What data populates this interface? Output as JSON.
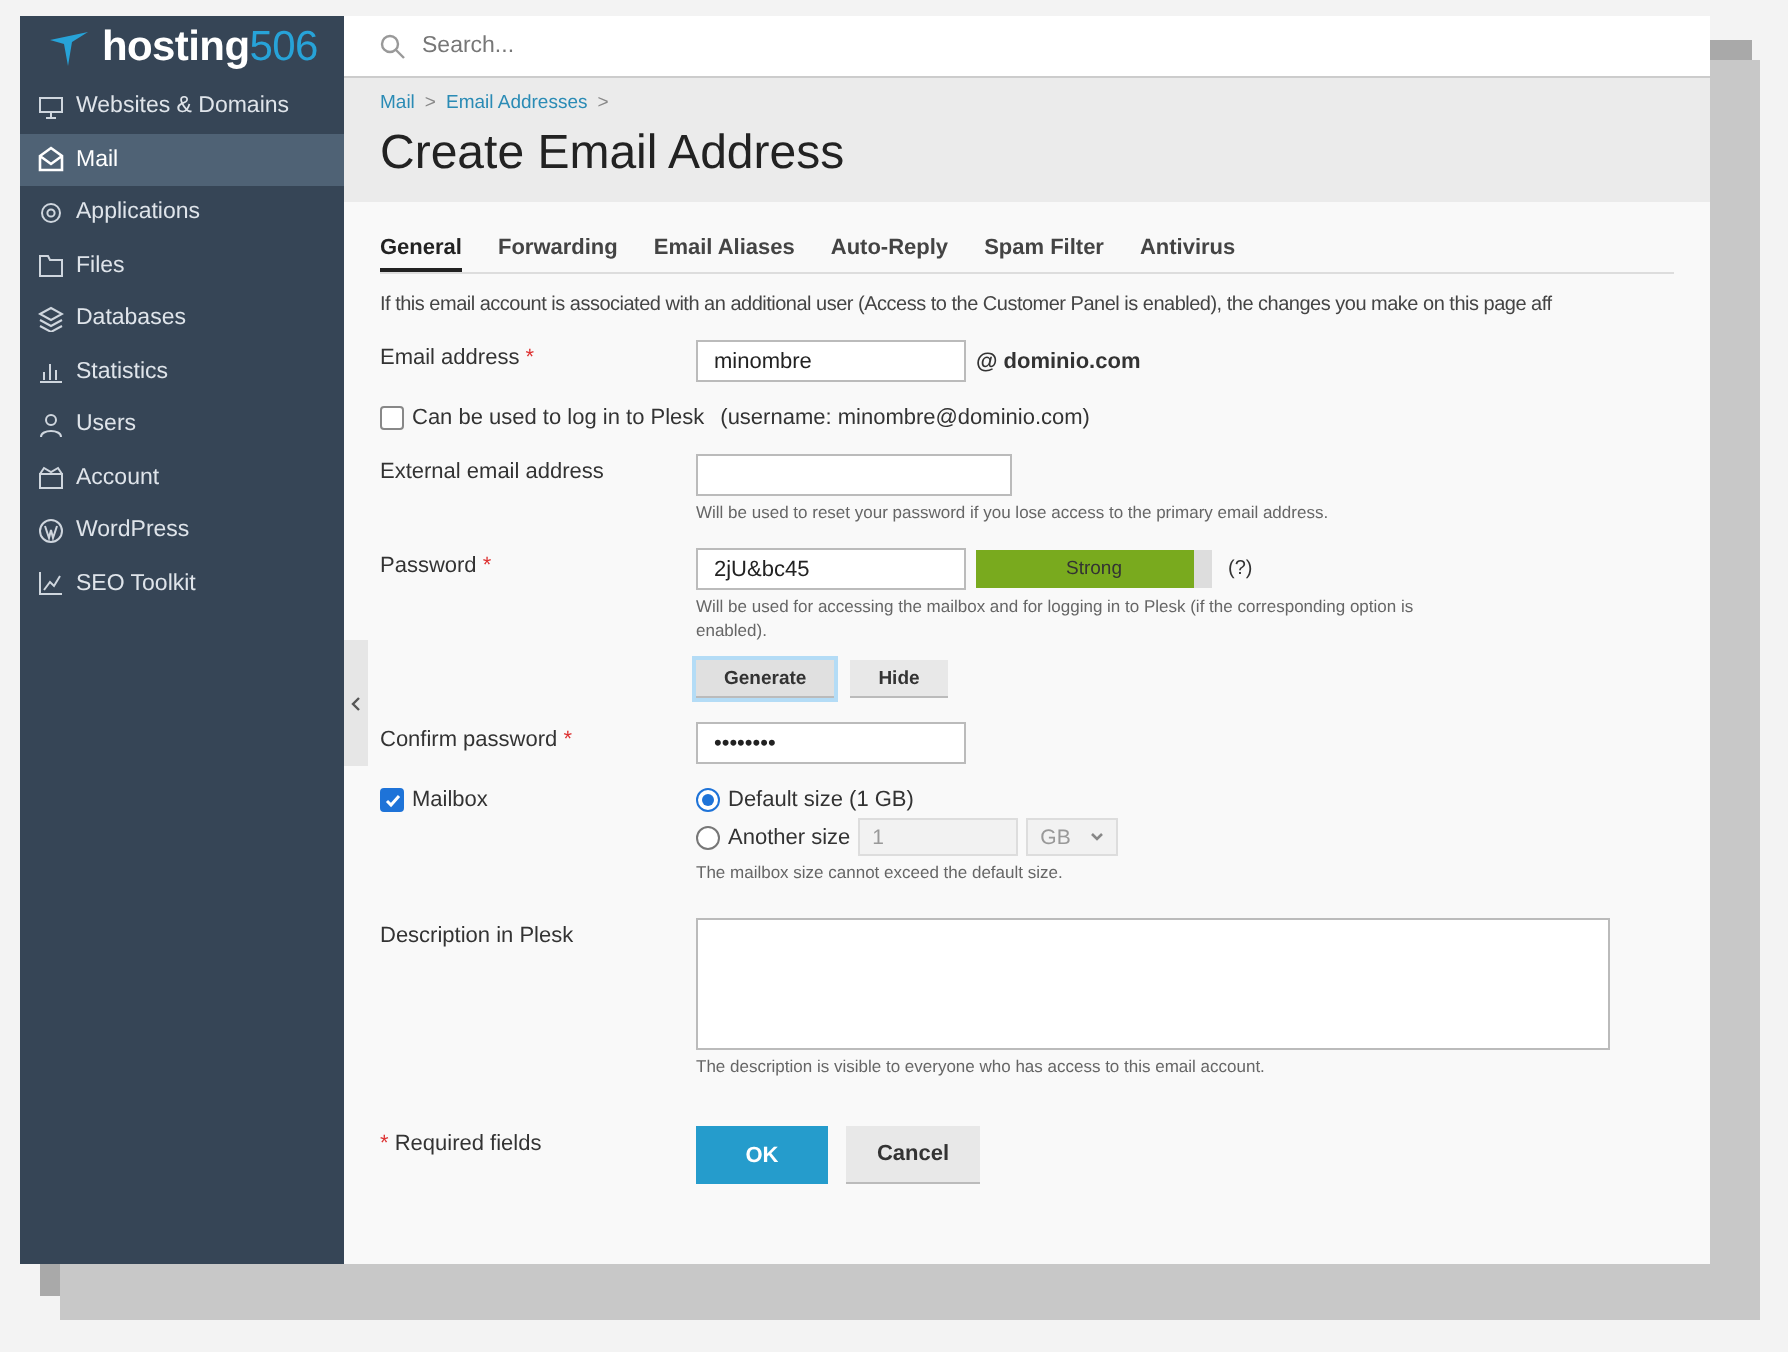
{
  "logo": {
    "name": "hosting",
    "suffix": "506"
  },
  "sidebar": {
    "items": [
      {
        "label": "Websites & Domains",
        "selected": false
      },
      {
        "label": "Mail",
        "selected": true
      },
      {
        "label": "Applications",
        "selected": false
      },
      {
        "label": "Files",
        "selected": false
      },
      {
        "label": "Databases",
        "selected": false
      },
      {
        "label": "Statistics",
        "selected": false
      },
      {
        "label": "Users",
        "selected": false
      },
      {
        "label": "Account",
        "selected": false
      },
      {
        "label": "WordPress",
        "selected": false
      },
      {
        "label": "SEO Toolkit",
        "selected": false
      }
    ]
  },
  "search": {
    "placeholder": "Search..."
  },
  "breadcrumbs": [
    {
      "label": "Mail",
      "separator": ">"
    },
    {
      "label": "Email Addresses",
      "separator": ">"
    }
  ],
  "page_title": "Create Email Address",
  "tabs": [
    {
      "label": "General",
      "selected": true
    },
    {
      "label": "Forwarding",
      "selected": false
    },
    {
      "label": "Email Aliases",
      "selected": false
    },
    {
      "label": "Auto-Reply",
      "selected": false
    },
    {
      "label": "Spam Filter",
      "selected": false
    },
    {
      "label": "Antivirus",
      "selected": false
    }
  ],
  "notice": "If this email account is associated with an additional user (Access to the Customer Panel is enabled), the changes you make on this page aff",
  "form": {
    "email": {
      "label": "Email address",
      "required": true,
      "value": "minombre",
      "domain": "@ dominio.com"
    },
    "login": {
      "label": "Can be used to log in to Plesk",
      "checked": false,
      "note": "(username: minombre@dominio.com)"
    },
    "external": {
      "label": "External email address",
      "hint": "Will be used to reset your password if you lose access to the primary email address."
    },
    "password": {
      "label": "Password",
      "required": true,
      "value": "2jU&bc45",
      "strength": {
        "label": "Strong",
        "level": 0.92
      },
      "help": "(?)",
      "hint": "Will be used for accessing the mailbox and for logging in to Plesk (if the corresponding option is enabled).",
      "buttons": [
        {
          "label": "Generate",
          "focused": true
        },
        {
          "label": "Hide",
          "focused": false
        }
      ]
    },
    "confirm": {
      "label": "Confirm password",
      "required": true,
      "value": "••••••••"
    },
    "mailbox": {
      "label": "Mailbox",
      "checked": true,
      "options": [
        {
          "label": "Default size (1 GB)",
          "selected": true
        },
        {
          "label": "Another size",
          "selected": false,
          "size": "1",
          "unit": "GB"
        }
      ],
      "hint": "The mailbox size cannot exceed the default size."
    },
    "description": {
      "label": "Description in Plesk",
      "hint": "The description is visible to everyone who has access to this email account."
    },
    "required_note": {
      "mark": "*",
      "text": "Required fields"
    },
    "buttons": [
      {
        "label": "OK",
        "kind": "primary"
      },
      {
        "label": "Cancel",
        "kind": "secondary"
      }
    ]
  }
}
